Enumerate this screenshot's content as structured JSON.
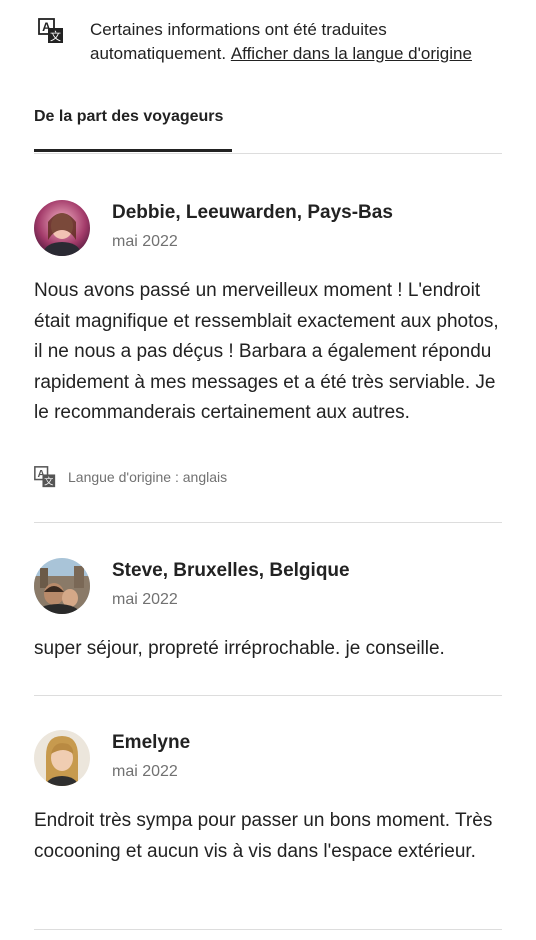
{
  "notice": {
    "text": "Certaines informations ont été traduites automatiquement. ",
    "link_label": "Afficher dans la langue d'origine",
    "icon": "translate-icon"
  },
  "tabs": {
    "active_label": "De la part des voyageurs"
  },
  "reviews": [
    {
      "name": "Debbie, Leeuwarden, Pays-Bas",
      "date": "mai 2022",
      "text": "Nous avons passé un merveilleux moment ! L'endroit était magnifique et ressemblait exactement aux photos, il ne nous a pas déçus ! Barbara a également répondu rapidement à mes messages et a été très serviable. Je le recommanderais certainement aux autres.",
      "original_language": "Langue d'origine : anglais"
    },
    {
      "name": "Steve, Bruxelles, Belgique",
      "date": "mai 2022",
      "text": "super séjour, propreté irréprochable. je conseille."
    },
    {
      "name": "Emelyne",
      "date": "mai 2022",
      "text": "Endroit très sympa pour passer un bons moment. Très cocooning et aucun vis à vis dans l'espace extérieur."
    }
  ],
  "colors": {
    "text": "#222222",
    "muted": "#717171",
    "divider": "#dddddd"
  }
}
